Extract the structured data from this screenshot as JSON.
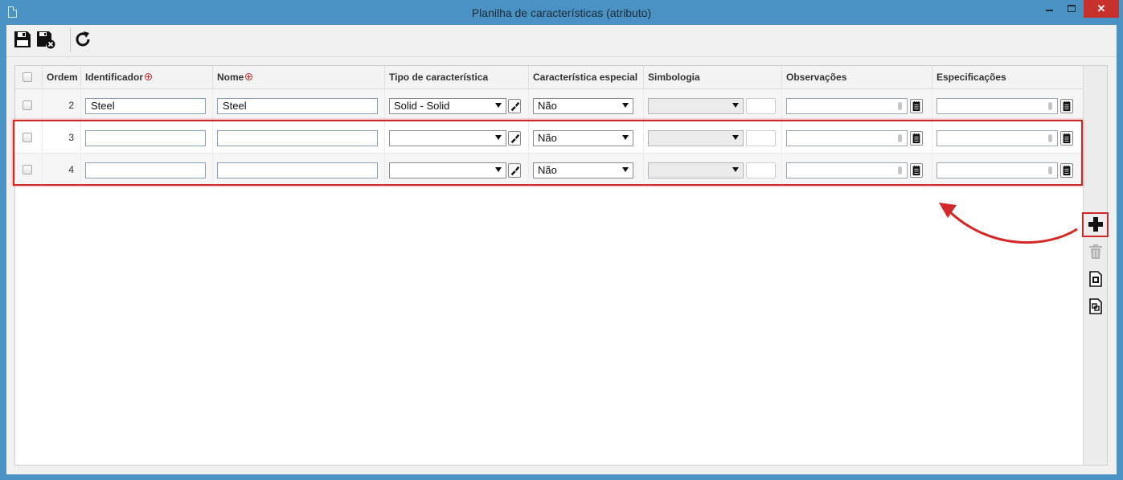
{
  "window": {
    "title": "Planilha de características (atributo)",
    "close_glyph": "✕"
  },
  "toolbar": {
    "save_icon": "floppy-disk-icon",
    "save_close_icon": "floppy-disk-close-icon",
    "refresh_icon": "refresh-icon"
  },
  "columns": {
    "ordem": "Ordem",
    "identificador": "Identificador",
    "nome": "Nome",
    "tipo": "Tipo de característica",
    "especial": "Característica especial",
    "simbologia": "Simbologia",
    "observacoes": "Observações",
    "especificacoes": "Especificações"
  },
  "rows": [
    {
      "ordem": "2",
      "identificador": "Steel",
      "nome": "Steel",
      "tipo": "Solid - Solid",
      "especial": "Não",
      "simbologia": ""
    },
    {
      "ordem": "3",
      "identificador": "",
      "nome": "",
      "tipo": "",
      "especial": "Não",
      "simbologia": ""
    },
    {
      "ordem": "4",
      "identificador": "",
      "nome": "",
      "tipo": "",
      "especial": "Não",
      "simbologia": ""
    }
  ],
  "sidebar": {
    "add_icon": "plus-icon",
    "delete_icon": "trash-icon",
    "copy_icon": "copy-document-icon",
    "paste_icon": "paste-document-icon"
  },
  "annotation": {
    "color": "#d42828"
  }
}
